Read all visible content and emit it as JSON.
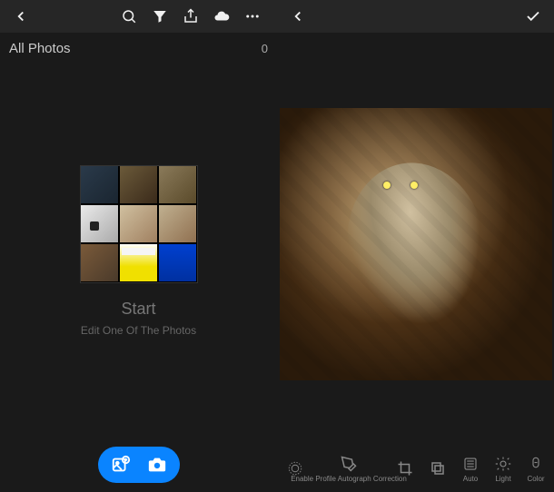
{
  "left": {
    "header_title": "All Photos",
    "photo_count": "0",
    "start_title": "Start",
    "start_subtitle": "Edit One Of The Photos"
  },
  "right": {
    "tools": {
      "profile_correction": "Enable Profile Autograph Correction",
      "auto": "Auto",
      "light": "Light",
      "color": "Color"
    }
  }
}
